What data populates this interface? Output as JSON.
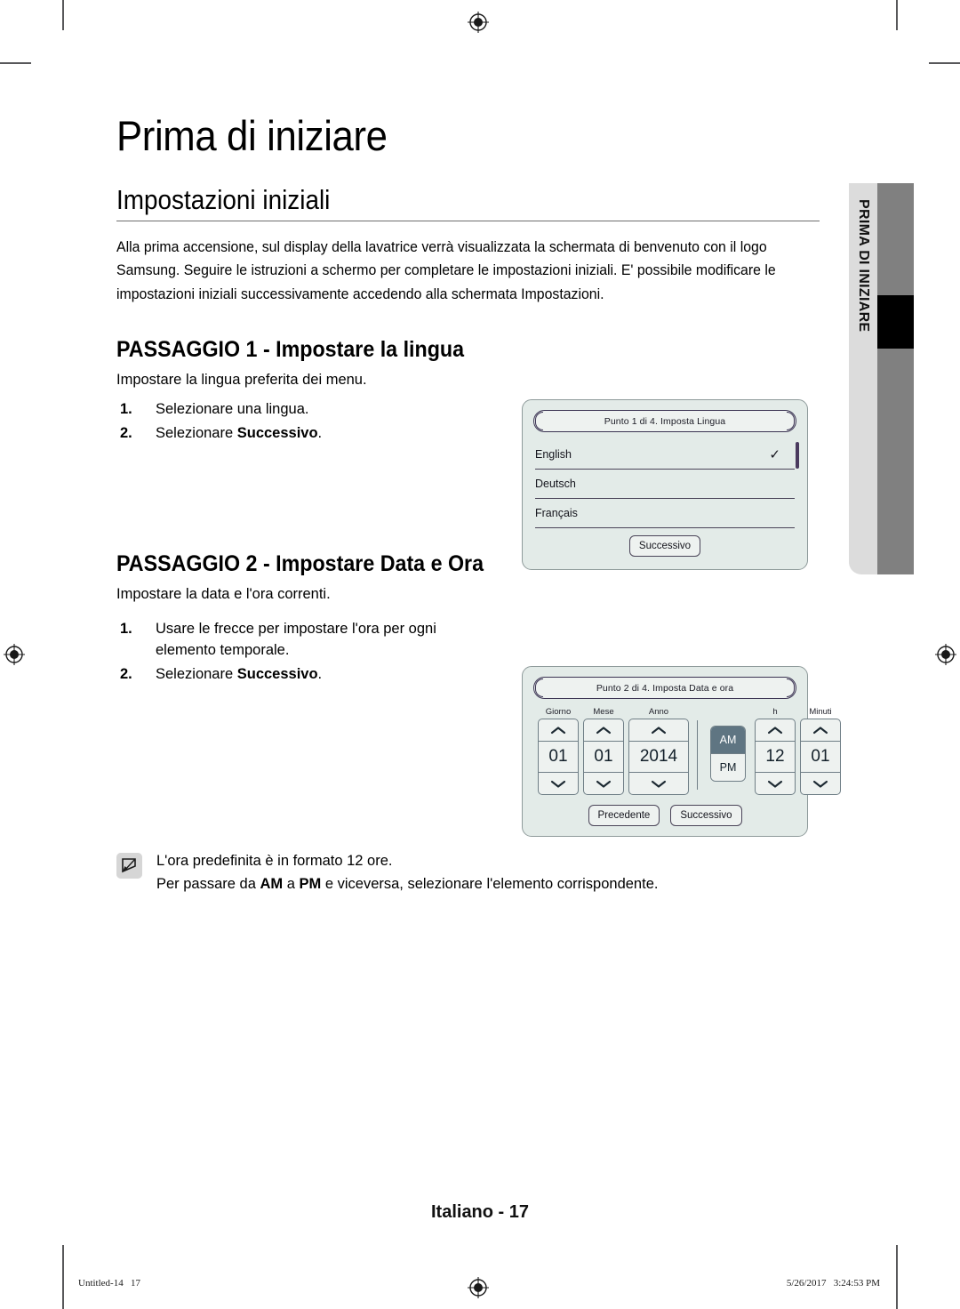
{
  "document": {
    "chapter_title": "Prima di iniziare",
    "section_title": "Impostazioni iniziali",
    "intro_paragraph": "Alla prima accensione, sul display della lavatrice verrà visualizzata la schermata di benvenuto con il logo Samsung. Seguire le istruzioni a schermo per completare le impostazioni iniziali. E' possibile modificare le impostazioni iniziali successivamente accedendo alla schermata Impostazioni."
  },
  "step1": {
    "title": "PASSAGGIO 1 - Impostare la lingua",
    "subtitle": "Impostare la lingua preferita dei menu.",
    "items": [
      {
        "num": "1.",
        "text": "Selezionare una lingua.",
        "bold_text": "",
        "suffix": ""
      },
      {
        "num": "2.",
        "text": "Selezionare ",
        "bold_text": "Successivo",
        "suffix": "."
      }
    ]
  },
  "step2": {
    "title": "PASSAGGIO 2 - Impostare Data e Ora",
    "subtitle": "Impostare la data e l'ora correnti.",
    "items": [
      {
        "num": "1.",
        "text": "Usare le frecce per impostare l'ora per ogni elemento temporale.",
        "bold_text": "",
        "suffix": ""
      },
      {
        "num": "2.",
        "text": "Selezionare ",
        "bold_text": "Successivo",
        "suffix": "."
      }
    ]
  },
  "language_screen": {
    "title": "Punto 1 di 4. Imposta Lingua",
    "options": [
      {
        "label": "English",
        "selected": true
      },
      {
        "label": "Deutsch",
        "selected": false
      },
      {
        "label": "Français",
        "selected": false
      }
    ],
    "check_glyph": "✓",
    "next_button": "Successivo"
  },
  "datetime_screen": {
    "title": "Punto 2 di 4. Imposta Data e ora",
    "fields": [
      {
        "caption": "Giorno",
        "value": "01"
      },
      {
        "caption": "Mese",
        "value": "01"
      },
      {
        "caption": "Anno",
        "value": "2014"
      },
      {
        "caption": "h",
        "value": "12"
      },
      {
        "caption": "Minuti",
        "value": "01"
      }
    ],
    "meridiem": {
      "am": "AM",
      "pm": "PM",
      "active": "AM"
    },
    "prev_button": "Precedente",
    "next_button": "Successivo"
  },
  "note": {
    "line1": "L'ora predefinita è in formato 12 ore.",
    "line2_part1": "Per passare da ",
    "line2_am": "AM",
    "line2_part2": " a ",
    "line2_pm": "PM",
    "line2_part3": " e viceversa, selezionare l'elemento corrispondente."
  },
  "side_tab": {
    "label": "PRIMA DI INIZIARE"
  },
  "footer": {
    "folio": "Italiano - 17",
    "print_file": "Untitled-14   17",
    "print_timestamp": "5/26/2017   3:24:53 PM"
  },
  "colors": {
    "screen_background": "#e3ebe8",
    "screen_border": "#8f9b9b",
    "title_pill_border": "#3a3352",
    "am_active_background": "#5f7582",
    "side_tab_background": "#dcdcdc",
    "side_bar_gray": "#808080",
    "side_bar_active": "#000000",
    "scrollbar": "#4a3a5e"
  }
}
